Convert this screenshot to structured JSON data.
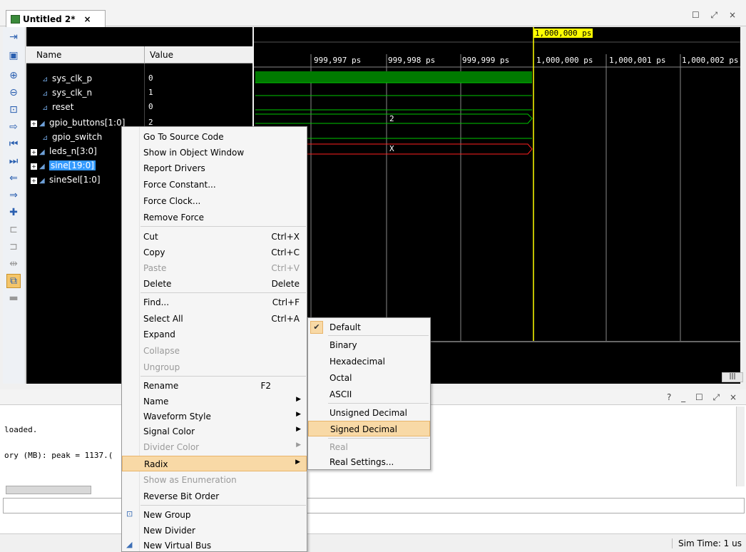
{
  "tab": {
    "title": "Untitled 2*",
    "close": "×"
  },
  "window_controls": "☐ ⤢ ×",
  "columns": {
    "name": "Name",
    "value": "Value"
  },
  "signals": [
    {
      "name": "sys_clk_p",
      "value": "0",
      "expandable": false
    },
    {
      "name": "sys_clk_n",
      "value": "1",
      "expandable": false
    },
    {
      "name": "reset",
      "value": "0",
      "expandable": false
    },
    {
      "name": "gpio_buttons[1:0]",
      "value": "2",
      "expandable": true
    },
    {
      "name": "gpio_switch",
      "value": "",
      "expandable": false
    },
    {
      "name": "leds_n[3:0]",
      "value": "",
      "expandable": true
    },
    {
      "name": "sine[19:0]",
      "value": "",
      "expandable": true,
      "selected": true
    },
    {
      "name": "sineSel[1:0]",
      "value": "",
      "expandable": true
    }
  ],
  "timeline": {
    "cursor": "1,000,000 ps",
    "ticks": [
      "999,997 ps",
      "999,998 ps",
      "999,999 ps",
      "1,000,000 ps",
      "1,000,001 ps",
      "1,000,002 ps"
    ]
  },
  "wave_values": {
    "gpio_buttons": "2",
    "leds_n": "X"
  },
  "context_menu": {
    "go_to_source": "Go To Source Code",
    "show_object": "Show in Object Window",
    "report_drivers": "Report Drivers",
    "force_constant": "Force Constant...",
    "force_clock": "Force Clock...",
    "remove_force": "Remove Force",
    "cut": "Cut",
    "cut_sc": "Ctrl+X",
    "copy": "Copy",
    "copy_sc": "Ctrl+C",
    "paste": "Paste",
    "paste_sc": "Ctrl+V",
    "delete": "Delete",
    "delete_sc": "Delete",
    "find": "Find...",
    "find_sc": "Ctrl+F",
    "select_all": "Select All",
    "select_all_sc": "Ctrl+A",
    "expand": "Expand",
    "collapse": "Collapse",
    "ungroup": "Ungroup",
    "rename": "Rename",
    "rename_sc": "F2",
    "name": "Name",
    "waveform_style": "Waveform Style",
    "signal_color": "Signal Color",
    "divider_color": "Divider Color",
    "radix": "Radix",
    "show_enum": "Show as Enumeration",
    "reverse_bits": "Reverse Bit Order",
    "new_group": "New Group",
    "new_divider": "New Divider",
    "new_virtual_bus": "New Virtual Bus"
  },
  "radix_menu": {
    "default": "Default",
    "binary": "Binary",
    "hex": "Hexadecimal",
    "octal": "Octal",
    "ascii": "ASCII",
    "unsigned": "Unsigned Decimal",
    "signed": "Signed Decimal",
    "real": "Real",
    "real_settings": "Real Settings..."
  },
  "console": {
    "controls": "? _ ☐ ⤢ ×",
    "line1": "loaded.",
    "line2": "ory (MB): peak = 1137.("
  },
  "status": {
    "sim_time": "Sim Time: 1 us"
  },
  "colors": {
    "waveform": "#00c800",
    "bus_x": "#ff2020",
    "cursor": "#ffff00",
    "highlight": "#f8d9a6"
  }
}
